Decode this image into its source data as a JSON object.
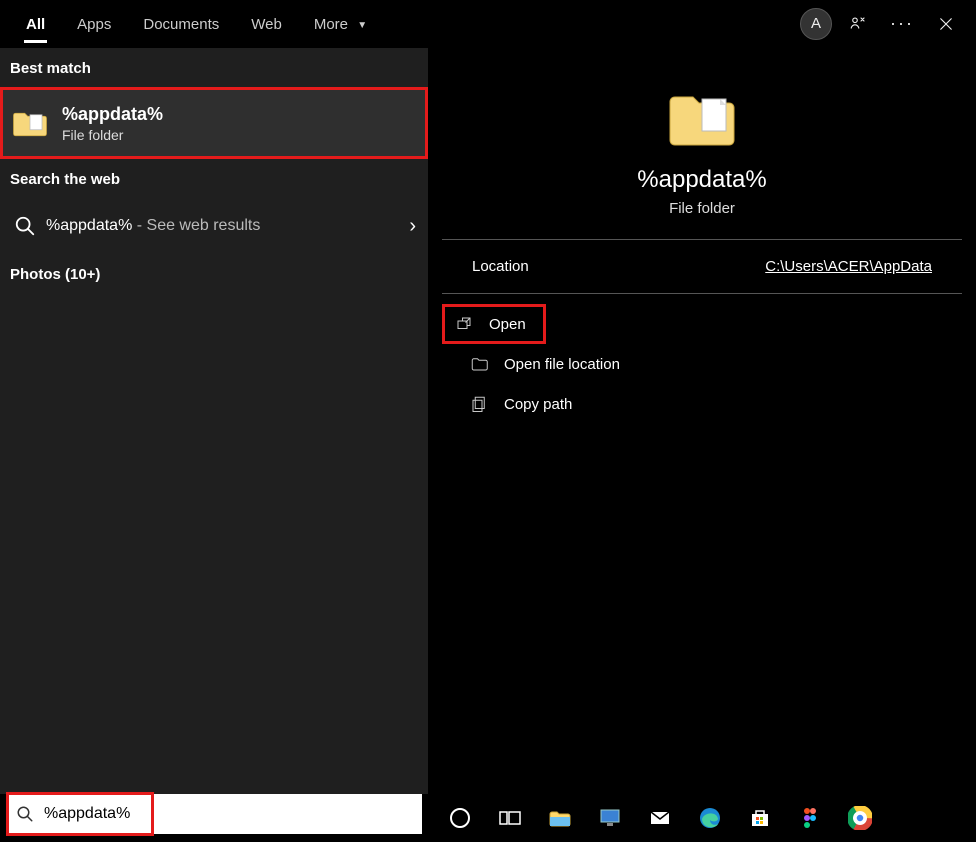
{
  "tabs": {
    "all": "All",
    "apps": "Apps",
    "documents": "Documents",
    "web": "Web",
    "more": "More"
  },
  "avatar_letter": "A",
  "left": {
    "best_match": "Best match",
    "result_title": "%appdata%",
    "result_sub": "File folder",
    "search_web": "Search the web",
    "web_query": "%appdata%",
    "web_suffix": " - See web results",
    "photos": "Photos (10+)"
  },
  "preview": {
    "title": "%appdata%",
    "sub": "File folder",
    "location_label": "Location",
    "location_path": "C:\\Users\\ACER\\AppData",
    "actions": {
      "open": "Open",
      "open_file_location": "Open file location",
      "copy_path": "Copy path"
    }
  },
  "search_value": "%appdata%"
}
